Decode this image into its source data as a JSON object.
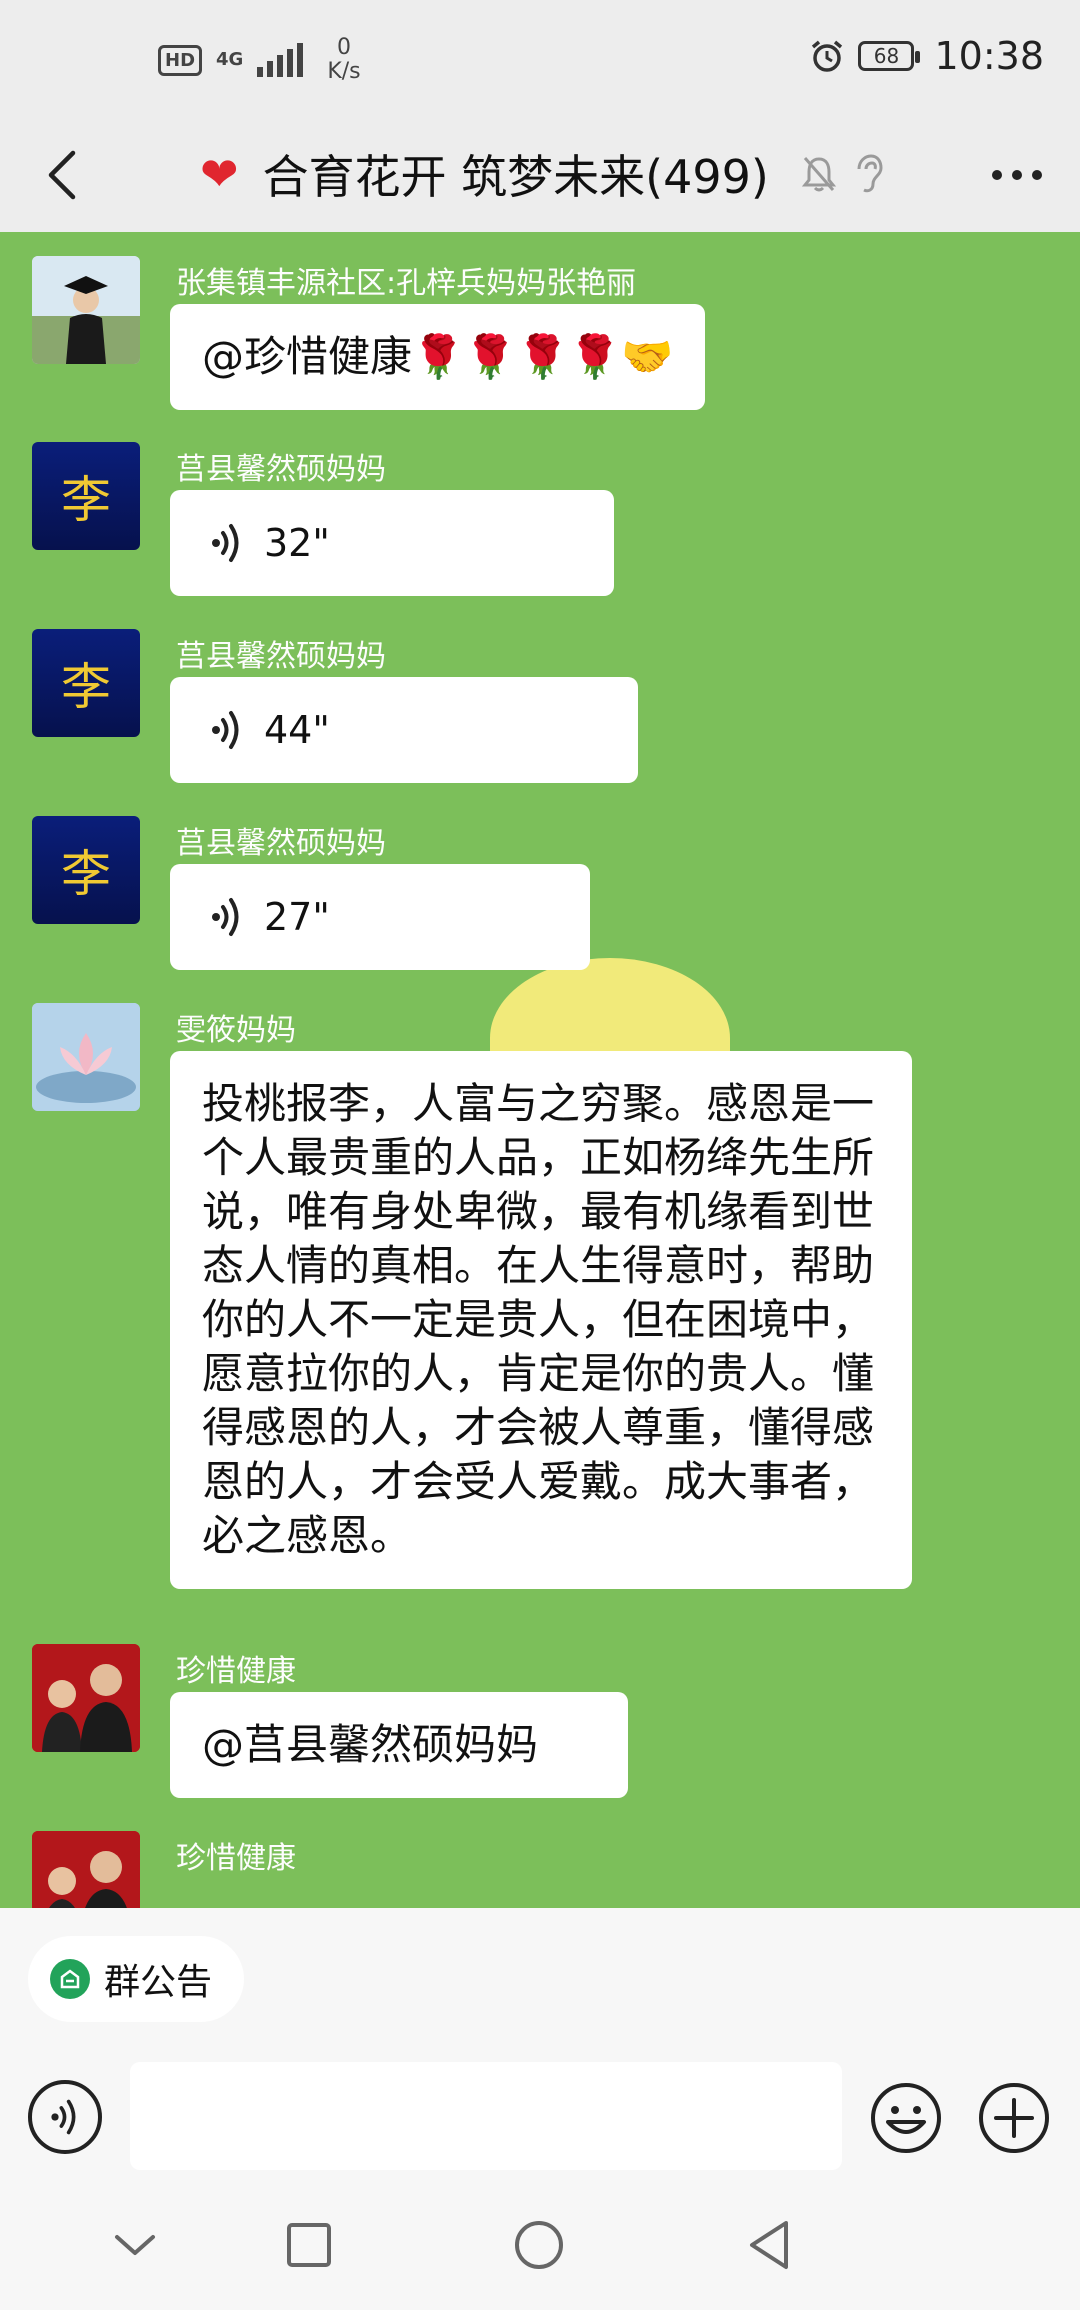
{
  "status_bar": {
    "hd": "HD",
    "network": "4G",
    "speed_value": "0",
    "speed_unit": "K/s",
    "battery": "68",
    "time": "10:38"
  },
  "header": {
    "title": "合育花开 筑梦未来(499)",
    "icons": [
      "back-arrow-icon",
      "heart-emoji-icon",
      "mute-bell-icon",
      "ear-icon",
      "more-dots-icon"
    ],
    "heart_color": "#e0262f"
  },
  "colors": {
    "chat_background": "#7cbf5a",
    "notice_icon": "#22a35a"
  },
  "messages": [
    {
      "sender": "张集镇丰源社区:孔梓兵妈妈张艳丽",
      "type": "text",
      "text": "@珍惜健康🌹🌹🌹🌹🤝"
    },
    {
      "sender": "莒县馨然硕妈妈",
      "type": "voice",
      "duration": "32\""
    },
    {
      "sender": "莒县馨然硕妈妈",
      "type": "voice",
      "duration": "44\""
    },
    {
      "sender": "莒县馨然硕妈妈",
      "type": "voice",
      "duration": "27\""
    },
    {
      "sender": "雯筱妈妈",
      "type": "text",
      "text": "投桃报李，人富与之穷聚。感恩是一个人最贵重的人品，正如杨绛先生所说，唯有身处卑微，最有机缘看到世态人情的真相。在人生得意时，帮助你的人不一定是贵人，但在困境中，愿意拉你的人，肯定是你的贵人。懂得感恩的人，才会被人尊重，懂得感恩的人，才会受人爱戴。成大事者，必之感恩。"
    },
    {
      "sender": "珍惜健康",
      "type": "text",
      "text": "@莒县馨然硕妈妈"
    },
    {
      "sender": "珍惜健康",
      "type": "partial",
      "text": ""
    }
  ],
  "avatar_text": {
    "li": "李"
  },
  "notice": {
    "label": "群公告"
  },
  "input": {
    "value": "",
    "placeholder": ""
  },
  "nav": {
    "icons": [
      "chevron-down-icon",
      "square-icon",
      "circle-icon",
      "triangle-back-icon"
    ]
  }
}
